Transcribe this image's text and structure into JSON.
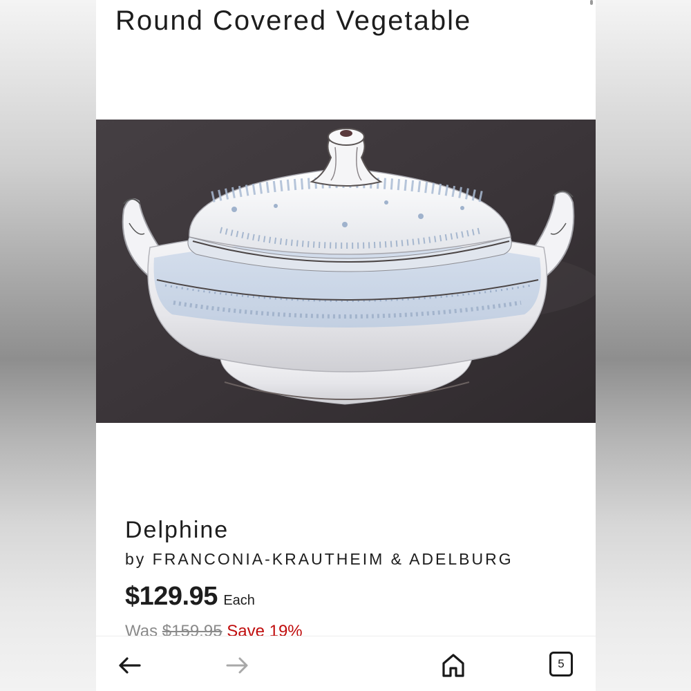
{
  "page": {
    "category_title": "Round Covered Vegetable"
  },
  "product": {
    "image_icon": "covered-vegetable-dish-photo",
    "pattern_name": "Delphine",
    "maker": "by FRANCONIA-KRAUTHEIM & ADELBURG",
    "price": "$129.95",
    "unit": "Each",
    "was_label": "Was",
    "was_price": "$159.95",
    "save_text": "Save 19%"
  },
  "browser_bar": {
    "back_icon": "arrow-left-icon",
    "forward_icon": "arrow-right-icon",
    "home_icon": "home-icon",
    "tabs_count": "5"
  },
  "colors": {
    "save_red": "#c00d0d",
    "text_dark": "#1d1d1d",
    "photo_background": "#3b3639"
  }
}
